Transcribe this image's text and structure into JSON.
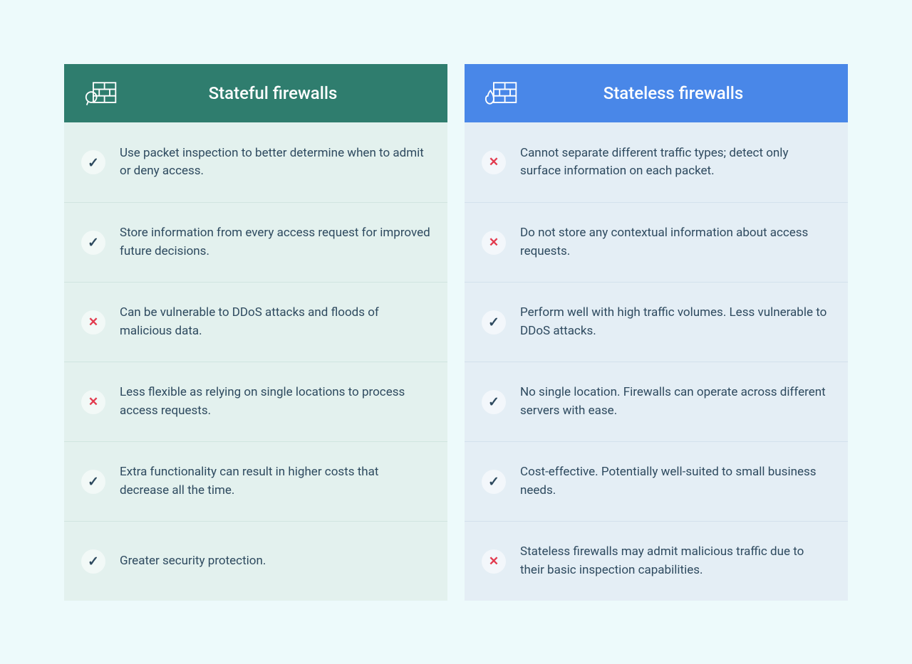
{
  "columns": [
    {
      "key": "stateful",
      "title": "Stateful firewalls",
      "items": [
        {
          "status": "check",
          "text": "Use packet inspection to better determine when to admit or deny access."
        },
        {
          "status": "check",
          "text": "Store information from every access request for improved future decisions."
        },
        {
          "status": "cross",
          "text": "Can be vulnerable to DDoS attacks and floods of malicious data."
        },
        {
          "status": "cross",
          "text": "Less flexible as relying on single locations to process access requests."
        },
        {
          "status": "check",
          "text": "Extra functionality can result in higher costs that decrease all the time."
        },
        {
          "status": "check",
          "text": "Greater security protection."
        }
      ]
    },
    {
      "key": "stateless",
      "title": "Stateless firewalls",
      "items": [
        {
          "status": "cross",
          "text": "Cannot separate different traffic types; detect only surface information on each packet."
        },
        {
          "status": "cross",
          "text": "Do not store any contextual information about access requests."
        },
        {
          "status": "check",
          "text": "Perform well with high traffic volumes. Less vulnerable to DDoS attacks."
        },
        {
          "status": "check",
          "text": "No single location. Firewalls can operate across different servers with ease."
        },
        {
          "status": "check",
          "text": "Cost-effective. Potentially well-suited to small business needs."
        },
        {
          "status": "cross",
          "text": "Stateless firewalls may admit malicious traffic due to their basic inspection capabilities."
        }
      ]
    }
  ]
}
